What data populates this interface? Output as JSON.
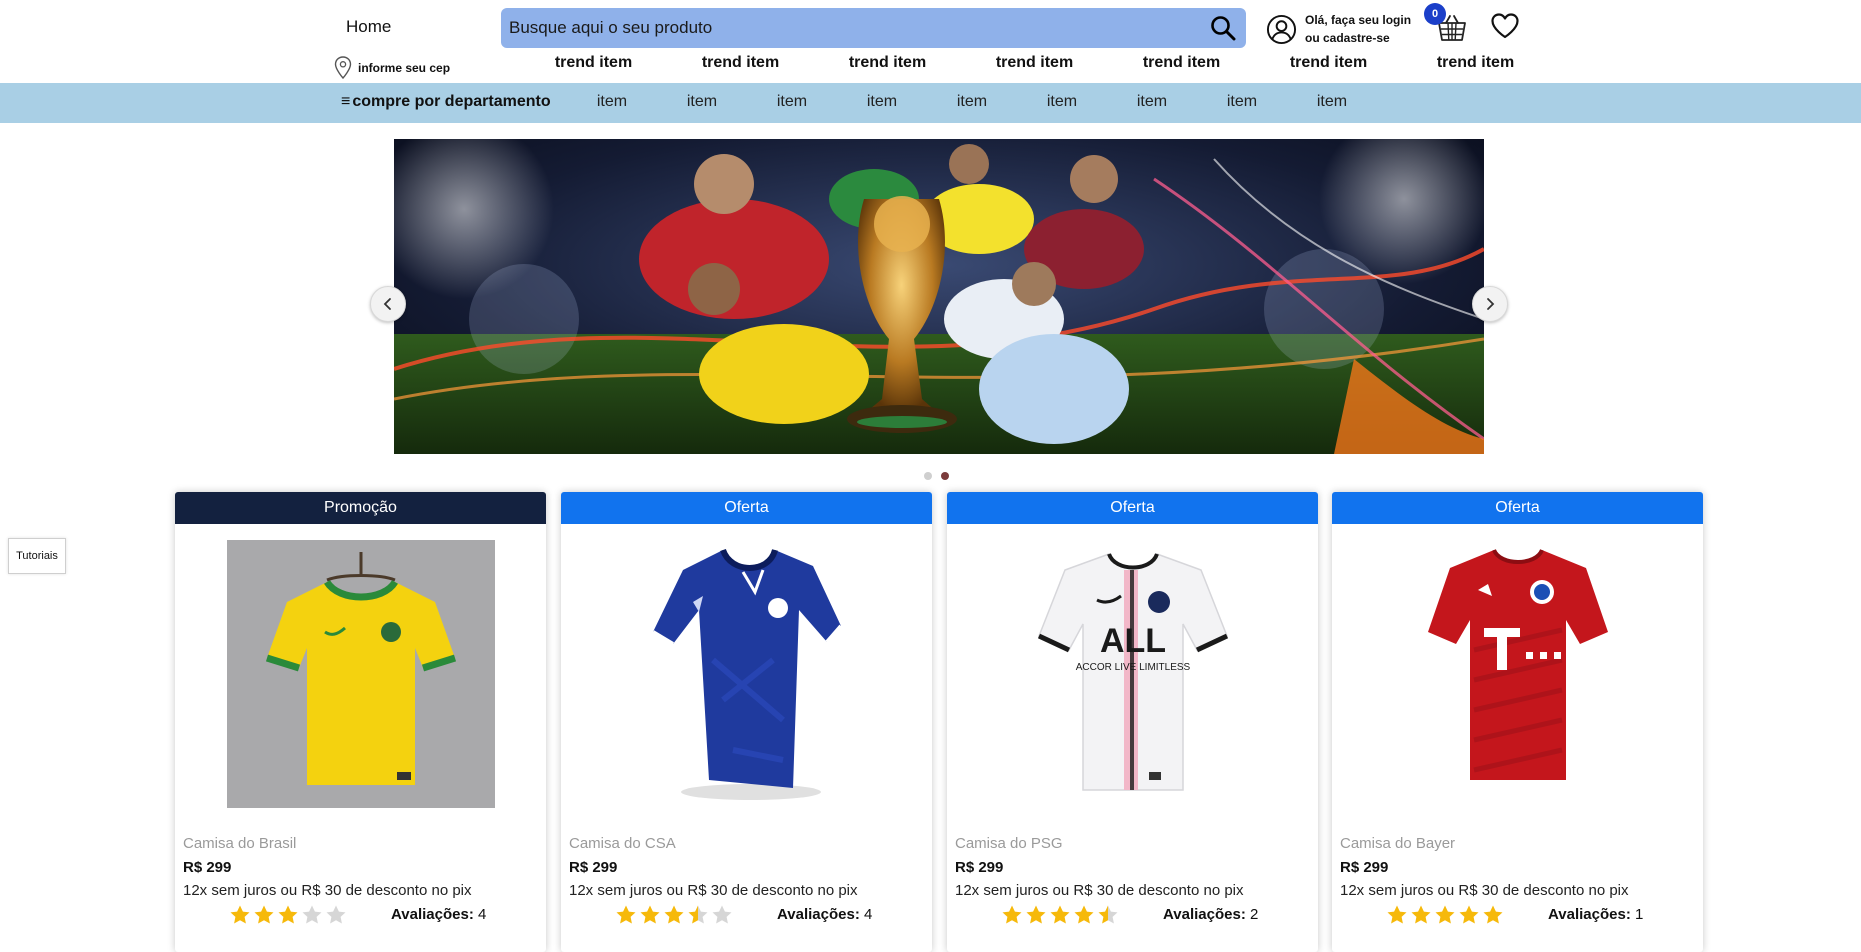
{
  "header": {
    "home_label": "Home",
    "cep_label": "informe seu cep",
    "search_placeholder": "Busque aqui o seu produto",
    "login_line1": "Olá, faça seu login",
    "login_line2": "ou cadastre-se",
    "cart_count": "0",
    "trend_items": [
      "trend item",
      "trend item",
      "trend item",
      "trend item",
      "trend item",
      "trend item",
      "trend item"
    ]
  },
  "dept_bar": {
    "menu_icon": "≡",
    "label": "compre por departamento",
    "items": [
      "item",
      "item",
      "item",
      "item",
      "item",
      "item",
      "item",
      "item",
      "item"
    ]
  },
  "carousel": {
    "slide_count": 2,
    "active_slide": 2
  },
  "tutorial_label": "Tutoriais",
  "products": [
    {
      "badge": "Promoção",
      "name": "Camisa do Brasil",
      "price": "R$ 299",
      "installments": "12x sem juros ou R$ 30 de desconto no pix",
      "rating": 3,
      "reviews_label": "Avaliações:",
      "reviews": "4",
      "shirt_color": "#f4d20f"
    },
    {
      "badge": "Oferta",
      "name": "Camisa do CSA",
      "price": "R$ 299",
      "installments": "12x sem juros ou R$ 30 de desconto no pix",
      "rating": 3.5,
      "reviews_label": "Avaliações:",
      "reviews": "4",
      "shirt_color": "#1f3a9e"
    },
    {
      "badge": "Oferta",
      "name": "Camisa do PSG",
      "price": "R$ 299",
      "installments": "12x sem juros ou R$ 30 de desconto no pix",
      "rating": 4.5,
      "reviews_label": "Avaliações:",
      "reviews": "2",
      "shirt_color": "#f3f3f5"
    },
    {
      "badge": "Oferta",
      "name": "Camisa do Bayer",
      "price": "R$ 299",
      "installments": "12x sem juros ou R$ 30 de desconto no pix",
      "rating": 5,
      "reviews_label": "Avaliações:",
      "reviews": "1",
      "shirt_color": "#c4161c"
    }
  ],
  "colors": {
    "search_bg": "#8fb1ea",
    "dept_bar_bg": "#a9cfe5",
    "promo_badge": "#13213f",
    "offer_badge": "#1173ee",
    "star": "#f6b90b"
  }
}
